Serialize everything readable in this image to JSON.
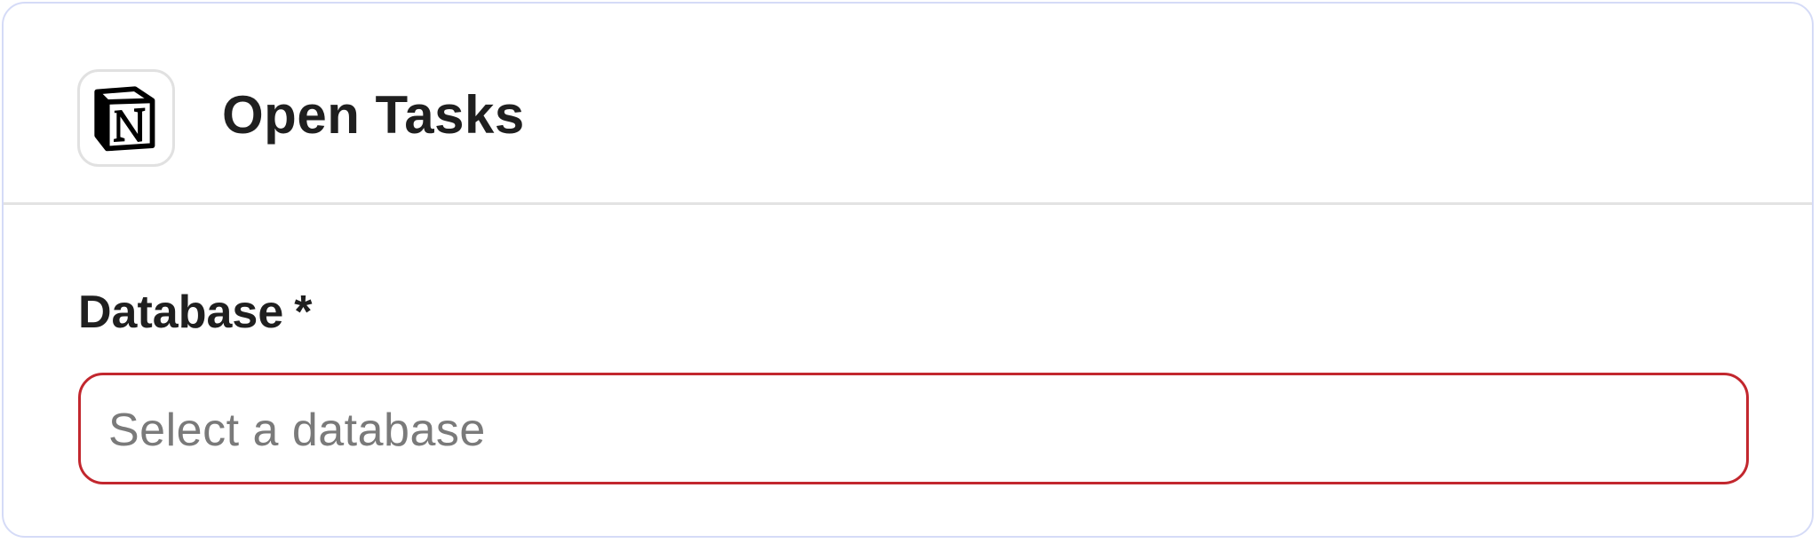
{
  "app": {
    "icon_name": "notion-logo-icon",
    "title": "Open Tasks"
  },
  "form": {
    "database_field": {
      "label": "Database",
      "required_marker": "*",
      "placeholder": "Select a database",
      "value": "",
      "state": "error"
    }
  },
  "colors": {
    "card_border": "#d5dbf7",
    "error_border": "#c2272e",
    "placeholder_text": "#7a7a7a",
    "text": "#1f1f1f"
  }
}
